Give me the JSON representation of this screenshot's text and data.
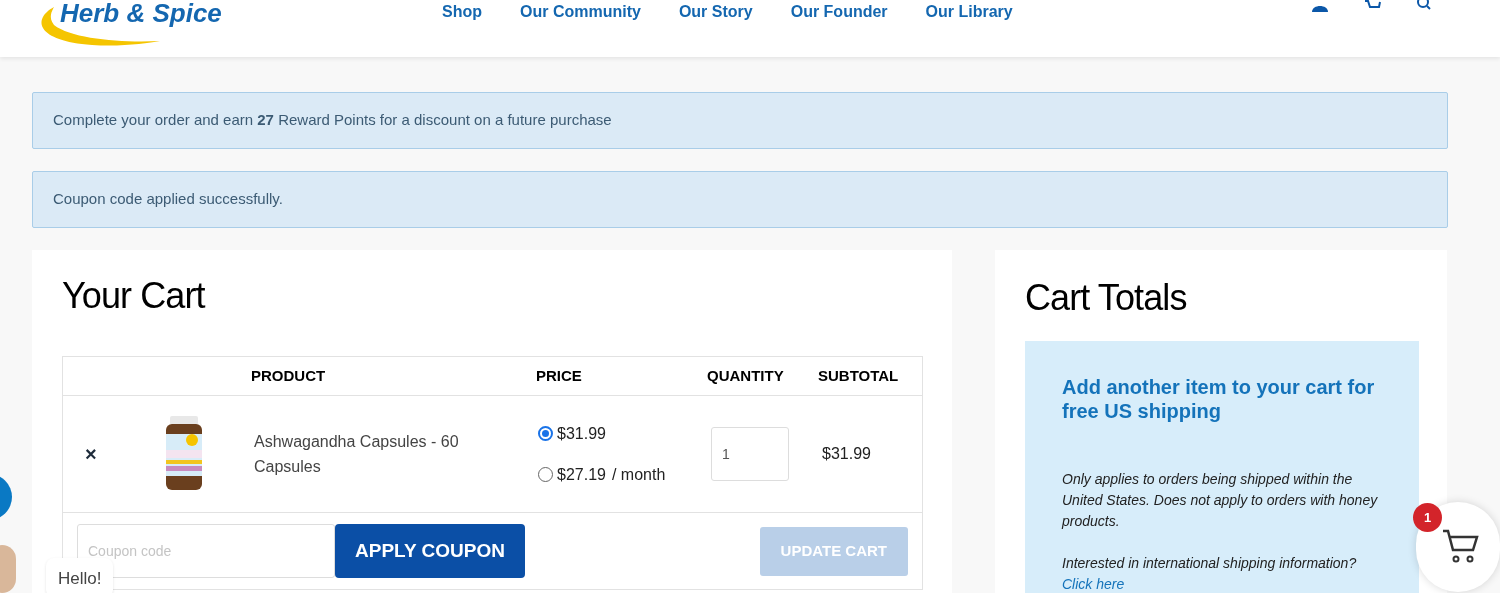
{
  "header": {
    "logo": "Herb & Spice",
    "nav": [
      "Shop",
      "Our Community",
      "Our Story",
      "Our Founder",
      "Our Library"
    ]
  },
  "notices": [
    "Complete your order and earn **27** Reward Points for a discount on a future purchase",
    "Coupon code applied successfully."
  ],
  "cart": {
    "title": "Your Cart",
    "columns": [
      "PRODUCT",
      "PRICE",
      "QUANTITY",
      "SUBTOTAL"
    ],
    "items": [
      {
        "remove": "×",
        "name": "Ashwagandha Capsules - 60 Capsules",
        "price_options": [
          {
            "price": "$31.99",
            "selected": true
          },
          {
            "price": "$27.19",
            "suffix": "/ month",
            "selected": false
          }
        ],
        "quantity": "1",
        "subtotal": "$31.99"
      }
    ],
    "coupon": {
      "placeholder": "Coupon code"
    },
    "apply_button": "APPLY COUPON",
    "update_button": {
      "label": "UPDATE CART",
      "disabled": true
    }
  },
  "totals": {
    "title": "Cart Totals",
    "shipping_heading": "Add another item to your cart for free US shipping",
    "note": "Only applies to orders being shipped within the United States. Does not apply to orders with honey products.",
    "intl_note": "Interested in international shipping information?",
    "intl_link": "Click here"
  },
  "floating_cart": {
    "count": "1"
  },
  "chat": {
    "greeting": "Hello!"
  }
}
